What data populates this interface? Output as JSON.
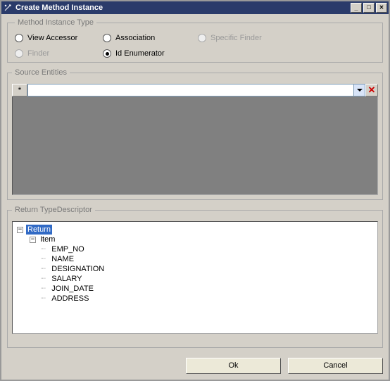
{
  "title": "Create Method Instance",
  "groups": {
    "method_instance_type": {
      "legend": "Method Instance Type",
      "options": [
        {
          "label": "View Accessor",
          "checked": false,
          "enabled": true
        },
        {
          "label": "Association",
          "checked": false,
          "enabled": true
        },
        {
          "label": "Specific Finder",
          "checked": false,
          "enabled": false
        },
        {
          "label": "Finder",
          "checked": false,
          "enabled": false
        },
        {
          "label": "Id Enumerator",
          "checked": true,
          "enabled": true
        }
      ]
    },
    "source_entities": {
      "legend": "Source Entities",
      "new_row_marker": "*",
      "combo_value": "",
      "delete_glyph": "✕"
    },
    "return_type_descriptor": {
      "legend": "Return TypeDescriptor",
      "tree": {
        "root": {
          "label": "Return",
          "expanded": true,
          "selected": true
        },
        "item": {
          "label": "Item",
          "expanded": true
        },
        "fields": [
          "EMP_NO",
          "NAME",
          "DESIGNATION",
          "SALARY",
          "JOIN_DATE",
          "ADDRESS"
        ]
      }
    }
  },
  "buttons": {
    "ok": "Ok",
    "cancel": "Cancel"
  },
  "sysbuttons": {
    "min": "_",
    "max": "□",
    "close": "✕"
  }
}
